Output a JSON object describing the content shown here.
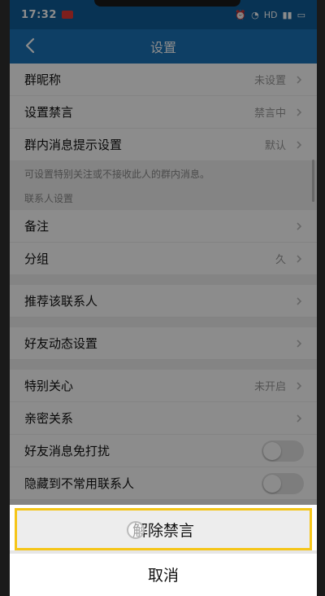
{
  "status": {
    "time": "17:32",
    "indicators": "HD"
  },
  "header": {
    "title": "设置"
  },
  "rows_group1": [
    {
      "label": "群昵称",
      "value": "未设置"
    },
    {
      "label": "设置禁言",
      "value": "禁言中"
    },
    {
      "label": "群内消息提示设置",
      "value": "默认"
    }
  ],
  "hint": "可设置特别关注或不接收此人的群内消息。",
  "contact_section": "联系人设置",
  "rows_group2": [
    {
      "label": "备注",
      "value": ""
    },
    {
      "label": "分组",
      "value": "久"
    }
  ],
  "row_recommend": {
    "label": "推荐该联系人"
  },
  "row_moments": {
    "label": "好友动态设置"
  },
  "rows_group3": [
    {
      "label": "特别关心",
      "value": "未开启"
    },
    {
      "label": "亲密关系",
      "value": ""
    }
  ],
  "toggles": [
    {
      "label": "好友消息免打扰",
      "on": false
    },
    {
      "label": "隐藏到不常用联系人",
      "on": false
    }
  ],
  "sheet": {
    "primary": "解除禁言",
    "cancel": "取消"
  }
}
